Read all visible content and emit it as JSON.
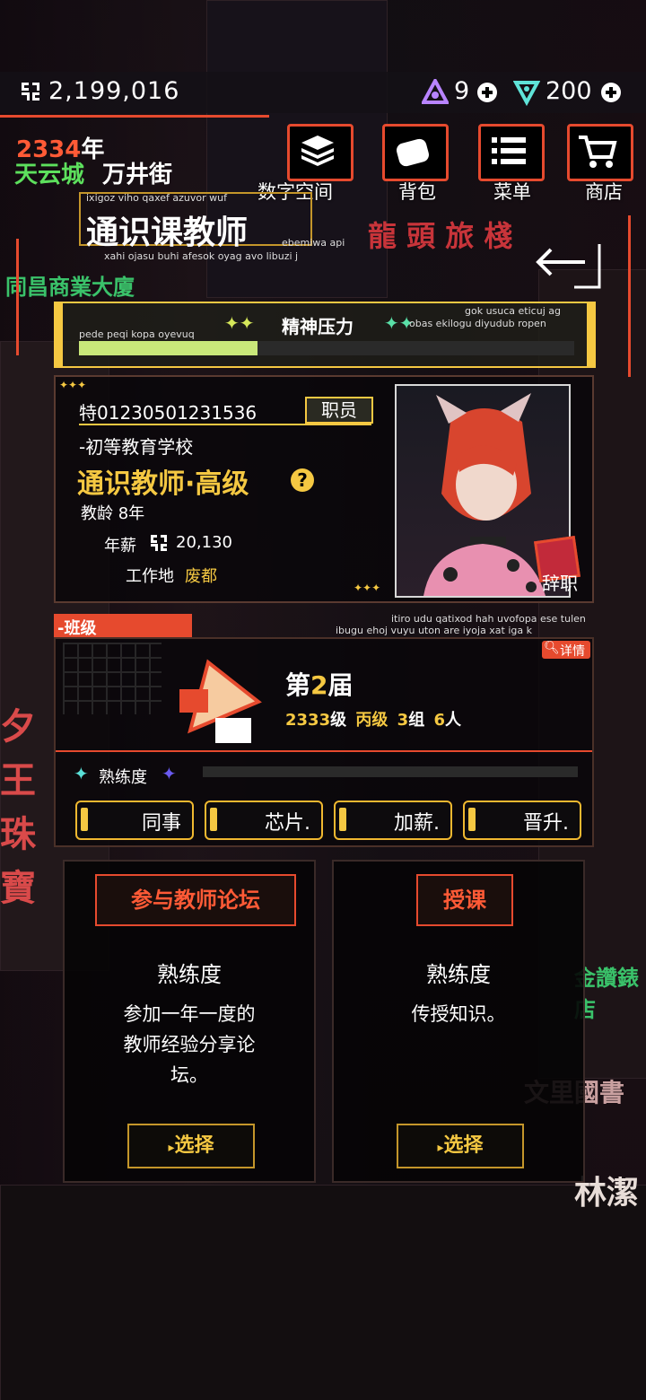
{
  "currency": {
    "money": "2,199,016",
    "gems_a": "9",
    "gems_b": "200"
  },
  "date": {
    "year": "2334",
    "year_unit": "年",
    "city": "天云城",
    "street": "万井街"
  },
  "nav": {
    "digital_space": "数字空间",
    "bag": "背包",
    "menu": "菜单",
    "shop": "商店"
  },
  "job_title": {
    "small_top": "ixigoz viho qaxef azuvor wuf",
    "title": "通识课教师",
    "small_right": "ebemiwa api",
    "small_bottom": "xahi ojasu buhi afesok oyag avo libuzi j"
  },
  "stress": {
    "label": "精神压力",
    "left_caption": "pede peqi kopa oyevuq",
    "right_caption_1": "gok usuca eticuj ag",
    "right_caption_2": "obas ekilogu diyudub ropen",
    "fill_fraction": 0.36
  },
  "profile": {
    "id": "特01230501231536",
    "badge": "职员",
    "school": "-初等教育学校",
    "position": "通识教师·高级",
    "years": "教龄 8年",
    "salary_label": "年薪",
    "salary": "20,130",
    "location_label": "工作地",
    "location": "废都",
    "resign": "辞职"
  },
  "class": {
    "tab": "-班级",
    "caption_1": "itiro udu qatixod hah uvofopa ese tulen",
    "caption_2": "ibugu ehoj vuyu uton are iyoja xat iga k",
    "detail": "详情",
    "session_prefix": "第",
    "session_num": "2",
    "session_suffix": "届",
    "grade_num": "2333",
    "grade_label": "级",
    "class_name": "丙级",
    "group_num": "3",
    "group_label": "组",
    "people_num": "6",
    "people_label": "人"
  },
  "skill": {
    "label": "熟练度"
  },
  "actions": {
    "colleague": "同事",
    "chip": "芯片.",
    "raise": "加薪.",
    "promote": "晋升."
  },
  "cards": [
    {
      "tag": "参与教师论坛",
      "skill": "熟练度",
      "desc_1": "参加一年一度的",
      "desc_2": "教师经验分享论",
      "desc_3": "坛。",
      "button": "选择"
    },
    {
      "tag": "授课",
      "skill": "熟练度",
      "desc_1": "传授知识。",
      "button": "选择"
    }
  ],
  "colors": {
    "accent": "#e64a2e",
    "gold": "#f5c842",
    "green": "#5de05d"
  }
}
